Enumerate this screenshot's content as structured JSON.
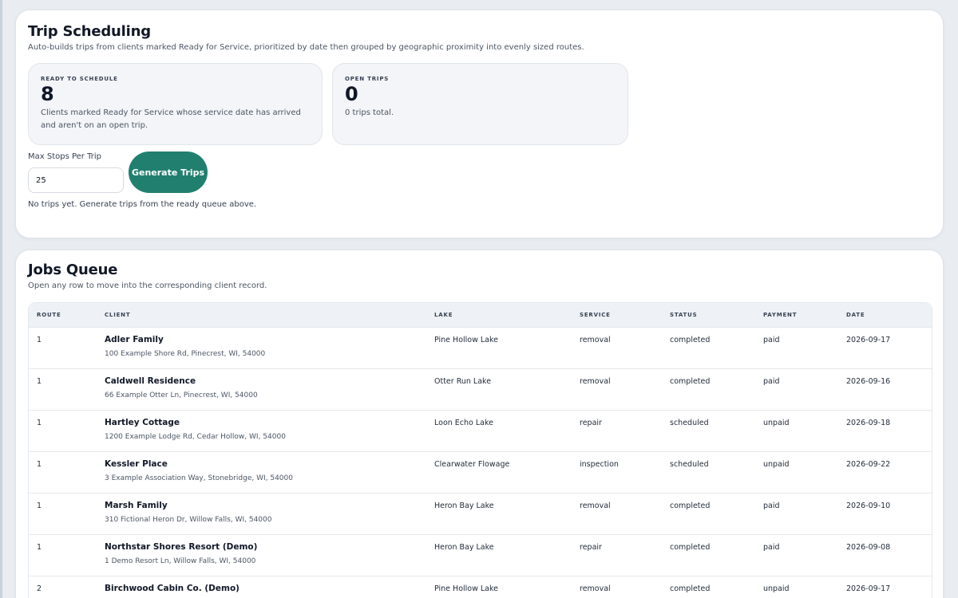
{
  "scheduling": {
    "title": "Trip Scheduling",
    "subtitle": "Auto-builds trips from clients marked Ready for Service, prioritized by date then grouped by geographic proximity into evenly sized routes.",
    "ready": {
      "label": "READY TO SCHEDULE",
      "value": "8",
      "description": "Clients marked Ready for Service whose service date has arrived and aren't on an open trip."
    },
    "open": {
      "label": "OPEN TRIPS",
      "value": "0",
      "description": "0 trips total."
    },
    "max_stops_label": "Max Stops Per Trip",
    "max_stops_value": "25",
    "generate_label": "Generate Trips",
    "empty_message": "No trips yet. Generate trips from the ready queue above."
  },
  "queue": {
    "title": "Jobs Queue",
    "subtitle": "Open any row to move into the corresponding client record.",
    "columns": {
      "route": "ROUTE",
      "client": "CLIENT",
      "lake": "LAKE",
      "service": "SERVICE",
      "status": "STATUS",
      "payment": "PAYMENT",
      "date": "DATE"
    },
    "rows": [
      {
        "route": "1",
        "name": "Adler Family",
        "address": "100 Example Shore Rd, Pinecrest, WI, 54000",
        "lake": "Pine Hollow Lake",
        "service": "removal",
        "status": "completed",
        "payment": "paid",
        "date": "2026-09-17"
      },
      {
        "route": "1",
        "name": "Caldwell Residence",
        "address": "66 Example Otter Ln, Pinecrest, WI, 54000",
        "lake": "Otter Run Lake",
        "service": "removal",
        "status": "completed",
        "payment": "paid",
        "date": "2026-09-16"
      },
      {
        "route": "1",
        "name": "Hartley Cottage",
        "address": "1200 Example Lodge Rd, Cedar Hollow, WI, 54000",
        "lake": "Loon Echo Lake",
        "service": "repair",
        "status": "scheduled",
        "payment": "unpaid",
        "date": "2026-09-18"
      },
      {
        "route": "1",
        "name": "Kessler Place",
        "address": "3 Example Association Way, Stonebridge, WI, 54000",
        "lake": "Clearwater Flowage",
        "service": "inspection",
        "status": "scheduled",
        "payment": "unpaid",
        "date": "2026-09-22"
      },
      {
        "route": "1",
        "name": "Marsh Family",
        "address": "310 Fictional Heron Dr, Willow Falls, WI, 54000",
        "lake": "Heron Bay Lake",
        "service": "removal",
        "status": "completed",
        "payment": "paid",
        "date": "2026-09-10"
      },
      {
        "route": "1",
        "name": "Northstar Shores Resort (Demo)",
        "address": "1 Demo Resort Ln, Willow Falls, WI, 54000",
        "lake": "Heron Bay Lake",
        "service": "repair",
        "status": "completed",
        "payment": "paid",
        "date": "2026-09-08"
      },
      {
        "route": "2",
        "name": "Birchwood Cabin Co. (Demo)",
        "address": "",
        "lake": "Pine Hollow Lake",
        "service": "removal",
        "status": "completed",
        "payment": "unpaid",
        "date": "2026-09-17"
      }
    ]
  }
}
